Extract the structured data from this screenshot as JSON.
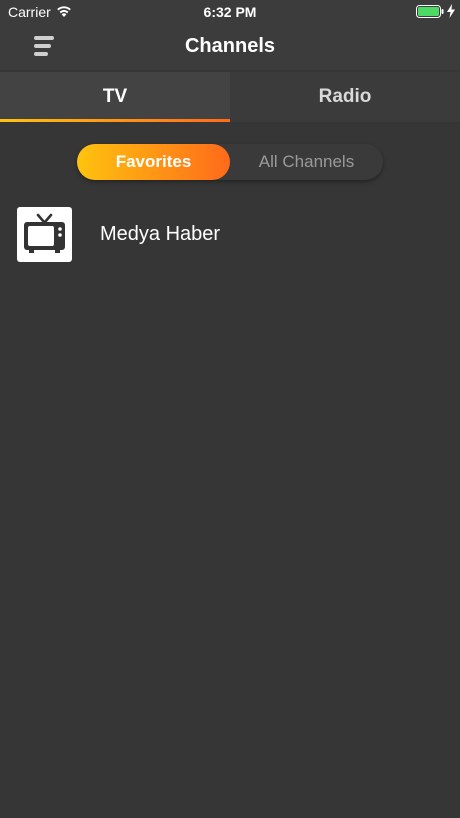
{
  "status_bar": {
    "carrier": "Carrier",
    "time": "6:32 PM",
    "icons": [
      "wifi-icon",
      "battery-icon",
      "charging-bolt-icon"
    ],
    "battery_color": "#4cd964"
  },
  "header": {
    "title": "Channels",
    "menu_icon": "hamburger-menu-icon"
  },
  "tabs": [
    {
      "label": "TV",
      "selected": true
    },
    {
      "label": "Radio",
      "selected": false
    }
  ],
  "filter": {
    "options": [
      {
        "label": "Favorites",
        "selected": true
      },
      {
        "label": "All Channels",
        "selected": false
      }
    ]
  },
  "channels": [
    {
      "name": "Medya Haber",
      "icon": "television-icon"
    }
  ],
  "colors": {
    "background": "#363636",
    "accent_start": "#ffc30f",
    "accent_end": "#ff6a1a"
  }
}
